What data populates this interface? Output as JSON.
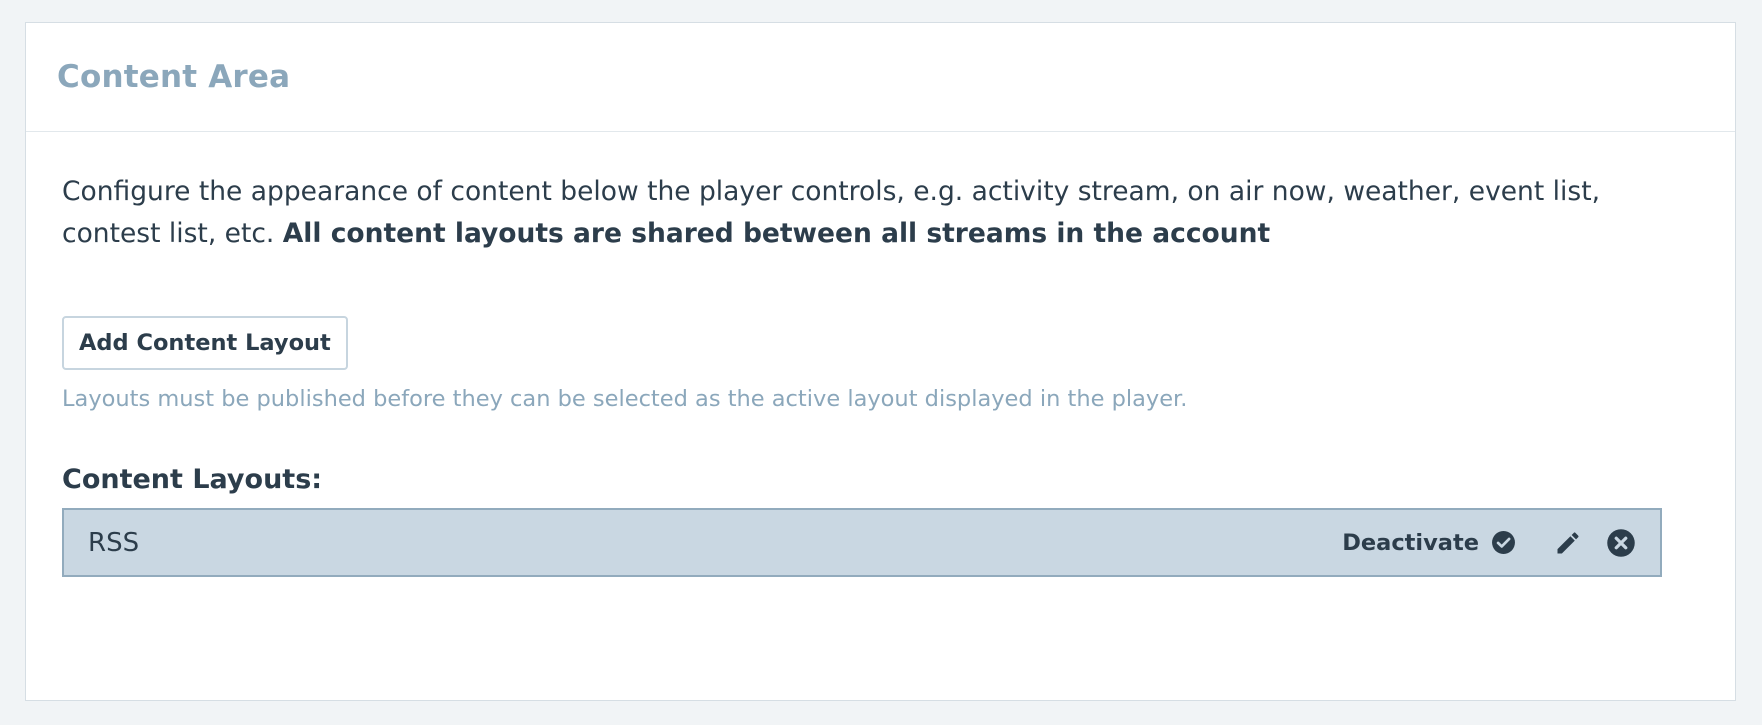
{
  "panel": {
    "title": "Content Area",
    "description_text": "Configure the appearance of content below the player controls, e.g. activity stream, on air now, weather, event list, contest list, etc.",
    "description_bold": "All content layouts are shared between all streams in the account",
    "add_button_label": "Add Content Layout",
    "hint": "Layouts must be published before they can be selected as the active layout displayed in the player.",
    "layouts_heading": "Content Layouts:",
    "layouts": [
      {
        "name": "RSS",
        "deactivate_label": "Deactivate",
        "icons": [
          "check-circle-icon",
          "pencil-icon",
          "close-circle-icon"
        ]
      }
    ]
  },
  "colors": {
    "background": "#f1f4f6",
    "title": "#8ba7bb",
    "text": "#2c3d4b",
    "hint": "#8ba7bb",
    "row_background": "#c9d7e2",
    "row_border": "#92abbd"
  }
}
